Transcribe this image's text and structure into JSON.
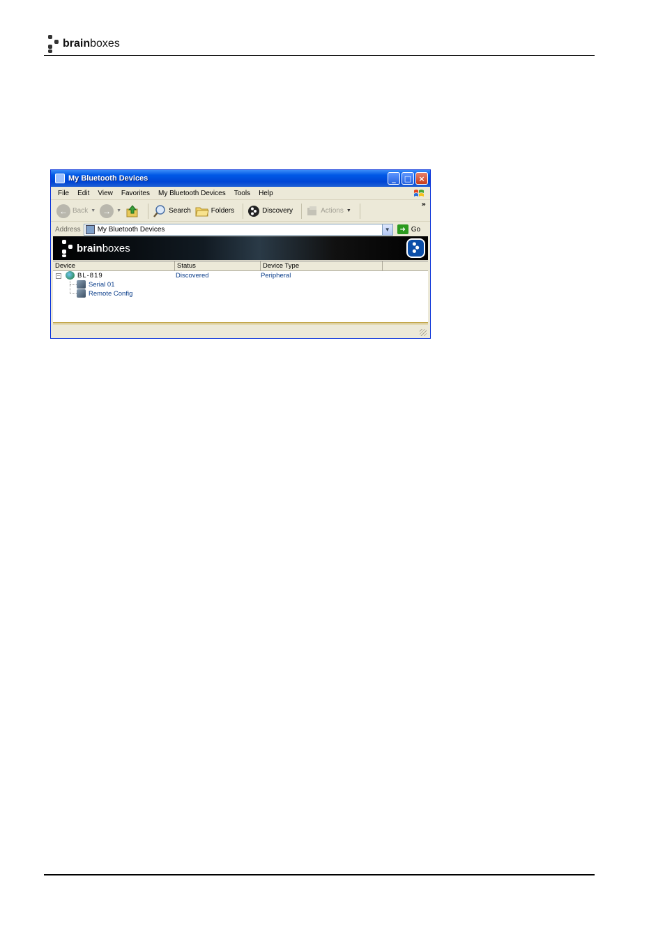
{
  "page": {
    "logo": {
      "brand_bold": "brain",
      "brand_light": "boxes"
    }
  },
  "window": {
    "title": "My Bluetooth Devices",
    "controls": {
      "minimize": "_",
      "maximize": "□",
      "close": "×"
    },
    "menu": [
      "File",
      "Edit",
      "View",
      "Favorites",
      "My Bluetooth Devices",
      "Tools",
      "Help"
    ],
    "toolbar": {
      "back": "Back",
      "search": "Search",
      "folders": "Folders",
      "discovery": "Discovery",
      "actions": "Actions",
      "overflow": "»"
    },
    "address": {
      "label": "Address",
      "value": "My Bluetooth Devices",
      "go": "Go"
    },
    "banner": {
      "brand_bold": "brain",
      "brand_light": "boxes"
    },
    "list": {
      "columns": [
        "Device",
        "Status",
        "Device Type"
      ],
      "device": {
        "name": "BL-819",
        "status": "Discovered",
        "type": "Peripheral"
      },
      "services": [
        "Serial 01",
        "Remote Config"
      ]
    }
  },
  "colors": {
    "titlebar": "#0058e6",
    "window_bg": "#ece9d8",
    "link_blue": "#0a3d8a",
    "banner": "#000000"
  }
}
